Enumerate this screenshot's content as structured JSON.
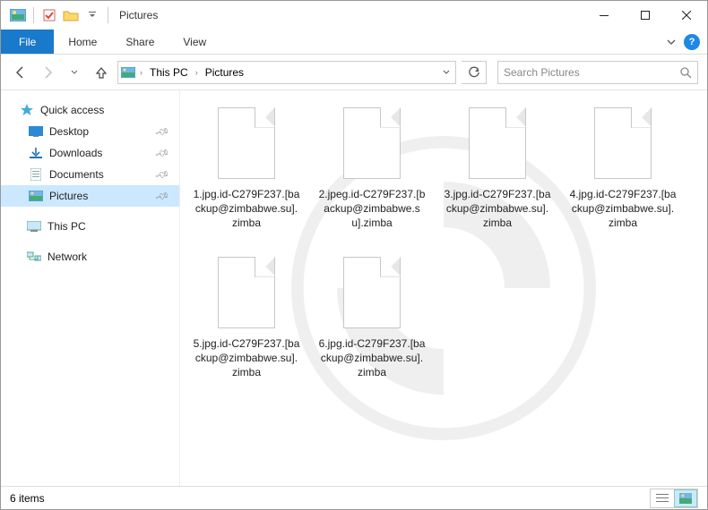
{
  "titlebar": {
    "title": "Pictures"
  },
  "ribbon": {
    "file": "File",
    "tabs": [
      "Home",
      "Share",
      "View"
    ]
  },
  "breadcrumb": {
    "segments": [
      "This PC",
      "Pictures"
    ]
  },
  "search": {
    "placeholder": "Search Pictures"
  },
  "sidebar": {
    "quick_access": "Quick access",
    "items": [
      {
        "label": "Desktop"
      },
      {
        "label": "Downloads"
      },
      {
        "label": "Documents"
      },
      {
        "label": "Pictures",
        "selected": true
      }
    ],
    "this_pc": "This PC",
    "network": "Network"
  },
  "files": [
    {
      "name": "1.jpg.id-C279F237.[backup@zimbabwe.su].zimba"
    },
    {
      "name": "2.jpeg.id-C279F237.[backup@zimbabwe.su].zimba"
    },
    {
      "name": "3.jpg.id-C279F237.[backup@zimbabwe.su].zimba"
    },
    {
      "name": "4.jpg.id-C279F237.[backup@zimbabwe.su].zimba"
    },
    {
      "name": "5.jpg.id-C279F237.[backup@zimbabwe.su].zimba"
    },
    {
      "name": "6.jpg.id-C279F237.[backup@zimbabwe.su].zimba"
    }
  ],
  "statusbar": {
    "count": "6 items"
  }
}
